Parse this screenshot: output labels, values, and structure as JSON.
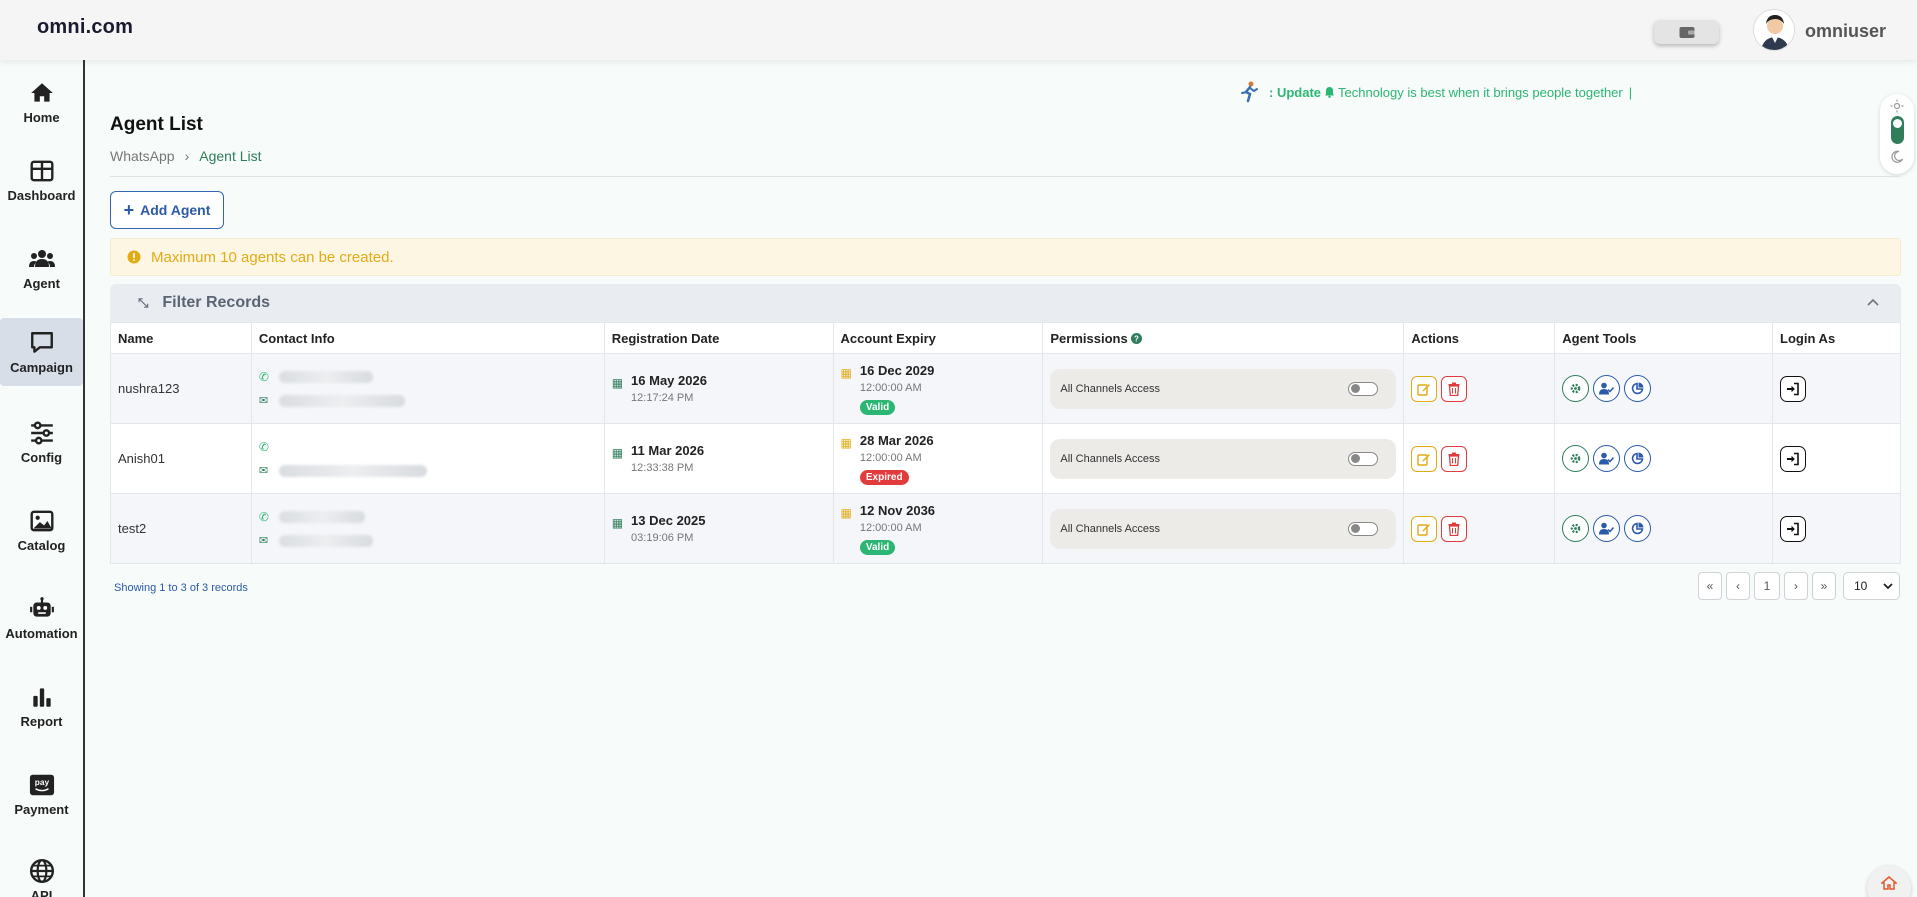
{
  "brand": "omni.com",
  "user": {
    "name": "omniuser"
  },
  "update": {
    "label": ": Update",
    "message": "Technology is best when it brings people together",
    "cursor": "|"
  },
  "sidebar": {
    "items": [
      {
        "label": "Home",
        "icon": "home-icon"
      },
      {
        "label": "Dashboard",
        "icon": "dashboard-icon"
      },
      {
        "label": "Agent",
        "icon": "users-icon"
      },
      {
        "label": "Campaign",
        "icon": "chat-icon"
      },
      {
        "label": "Config",
        "icon": "sliders-icon"
      },
      {
        "label": "Catalog",
        "icon": "image-icon"
      },
      {
        "label": "Automation",
        "icon": "robot-icon"
      },
      {
        "label": "Report",
        "icon": "bar-chart-icon"
      },
      {
        "label": "Payment",
        "icon": "pay-icon"
      },
      {
        "label": "API",
        "icon": "globe-icon"
      }
    ],
    "active": "Campaign"
  },
  "page": {
    "title": "Agent List",
    "breadcrumb": [
      "WhatsApp",
      "Agent List"
    ],
    "add_button": "Add Agent",
    "alert": "Maximum 10 agents can be created.",
    "filter_title": "Filter Records"
  },
  "table": {
    "headers": [
      "Name",
      "Contact Info",
      "Registration Date",
      "Account Expiry",
      "Permissions",
      "Actions",
      "Agent Tools",
      "Login As"
    ],
    "rows": [
      {
        "name": "nushra123",
        "reg_date": "16 May 2026",
        "reg_time": "12:17:24 PM",
        "exp_date": "16 Dec 2029",
        "exp_time": "12:00:00 AM",
        "status": "Valid",
        "permission": "All Channels Access"
      },
      {
        "name": "Anish01",
        "reg_date": "11 Mar 2026",
        "reg_time": "12:33:38 PM",
        "exp_date": "28 Mar 2026",
        "exp_time": "12:00:00 AM",
        "status": "Expired",
        "permission": "All Channels Access"
      },
      {
        "name": "test2",
        "reg_date": "13 Dec 2025",
        "reg_time": "03:19:06 PM",
        "exp_date": "12 Nov 2036",
        "exp_time": "12:00:00 AM",
        "status": "Valid",
        "permission": "All Channels Access"
      }
    ]
  },
  "pagination": {
    "showing": "Showing 1 to 3 of 3 records",
    "first": "«",
    "prev": "‹",
    "current": "1",
    "next": "›",
    "last": "»",
    "per_page": "10"
  },
  "colors": {
    "accent_green": "#2f7d5b",
    "valid": "#2bb673",
    "expired": "#e23b3b",
    "warning": "#e2ab16",
    "link_blue": "#2a5aa8"
  }
}
